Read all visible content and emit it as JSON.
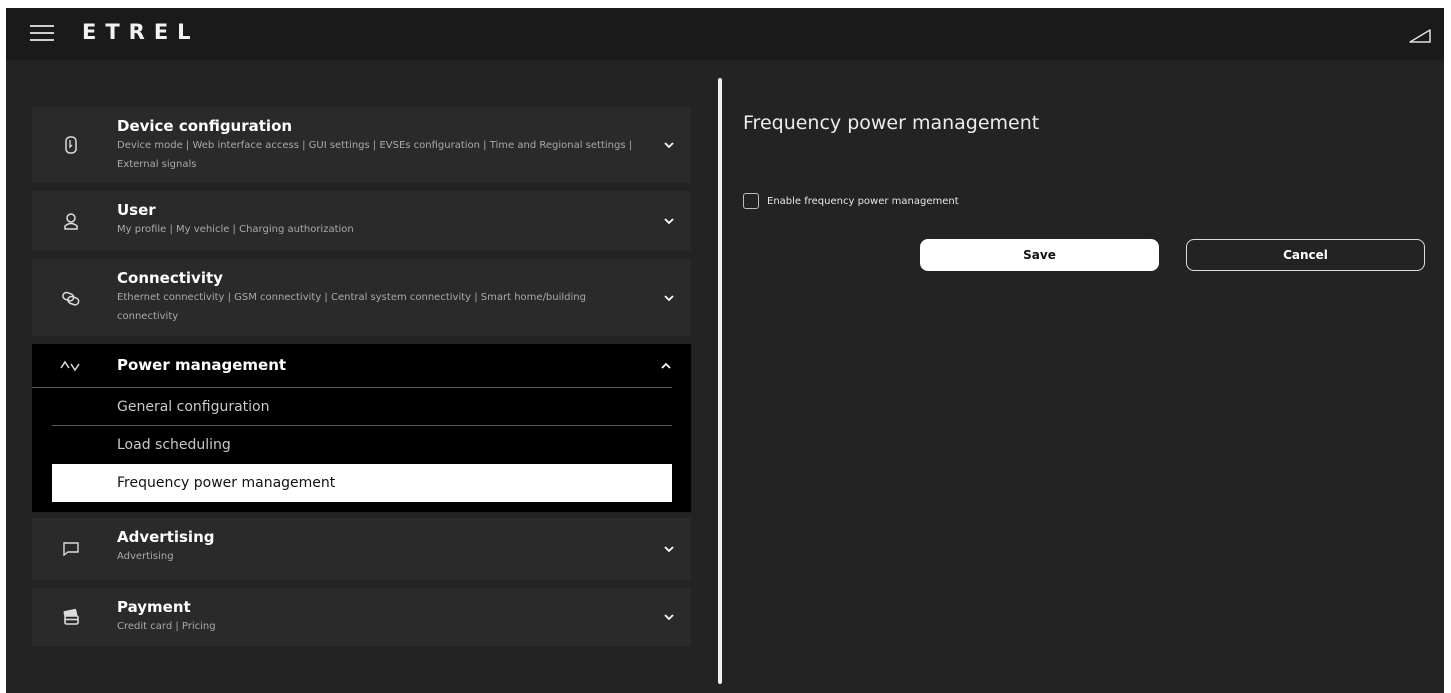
{
  "header": {
    "logo": "ETREL",
    "menu_icon": "hamburger-menu-icon",
    "status_icon": "signal-strength-icon"
  },
  "menu": {
    "sections": [
      {
        "title": "Device configuration",
        "subtitle": "Device mode  |  Web interface access  |  GUI settings  |  EVSEs configuration  |  Time and Regional settings  |  External signals",
        "icon": "device-icon"
      },
      {
        "title": "User",
        "subtitle": "My profile  |  My vehicle  |  Charging authorization",
        "icon": "user-icon"
      },
      {
        "title": "Connectivity",
        "subtitle": "Ethernet connectivity  |  GSM connectivity  |  Central system connectivity  |  Smart home/building connectivity",
        "icon": "link-icon"
      },
      {
        "title": "Power management",
        "icon": "power-wave-icon",
        "items": [
          "General configuration",
          "Load scheduling",
          "Frequency power management"
        ]
      },
      {
        "title": "Advertising",
        "subtitle": "Advertising",
        "icon": "chat-bubble-icon"
      },
      {
        "title": "Payment",
        "subtitle": "Credit card  |  Pricing",
        "icon": "payment-card-icon"
      }
    ]
  },
  "panel": {
    "title": "Frequency power management",
    "checkbox_label": "Enable frequency power management",
    "checkbox_checked": false,
    "save_label": "Save",
    "cancel_label": "Cancel"
  },
  "colors": {
    "background": "#232323",
    "topbar": "#1a1a1a",
    "section": "#2a2a2a",
    "active_section": "#000000",
    "active_item": "#ffffff"
  }
}
